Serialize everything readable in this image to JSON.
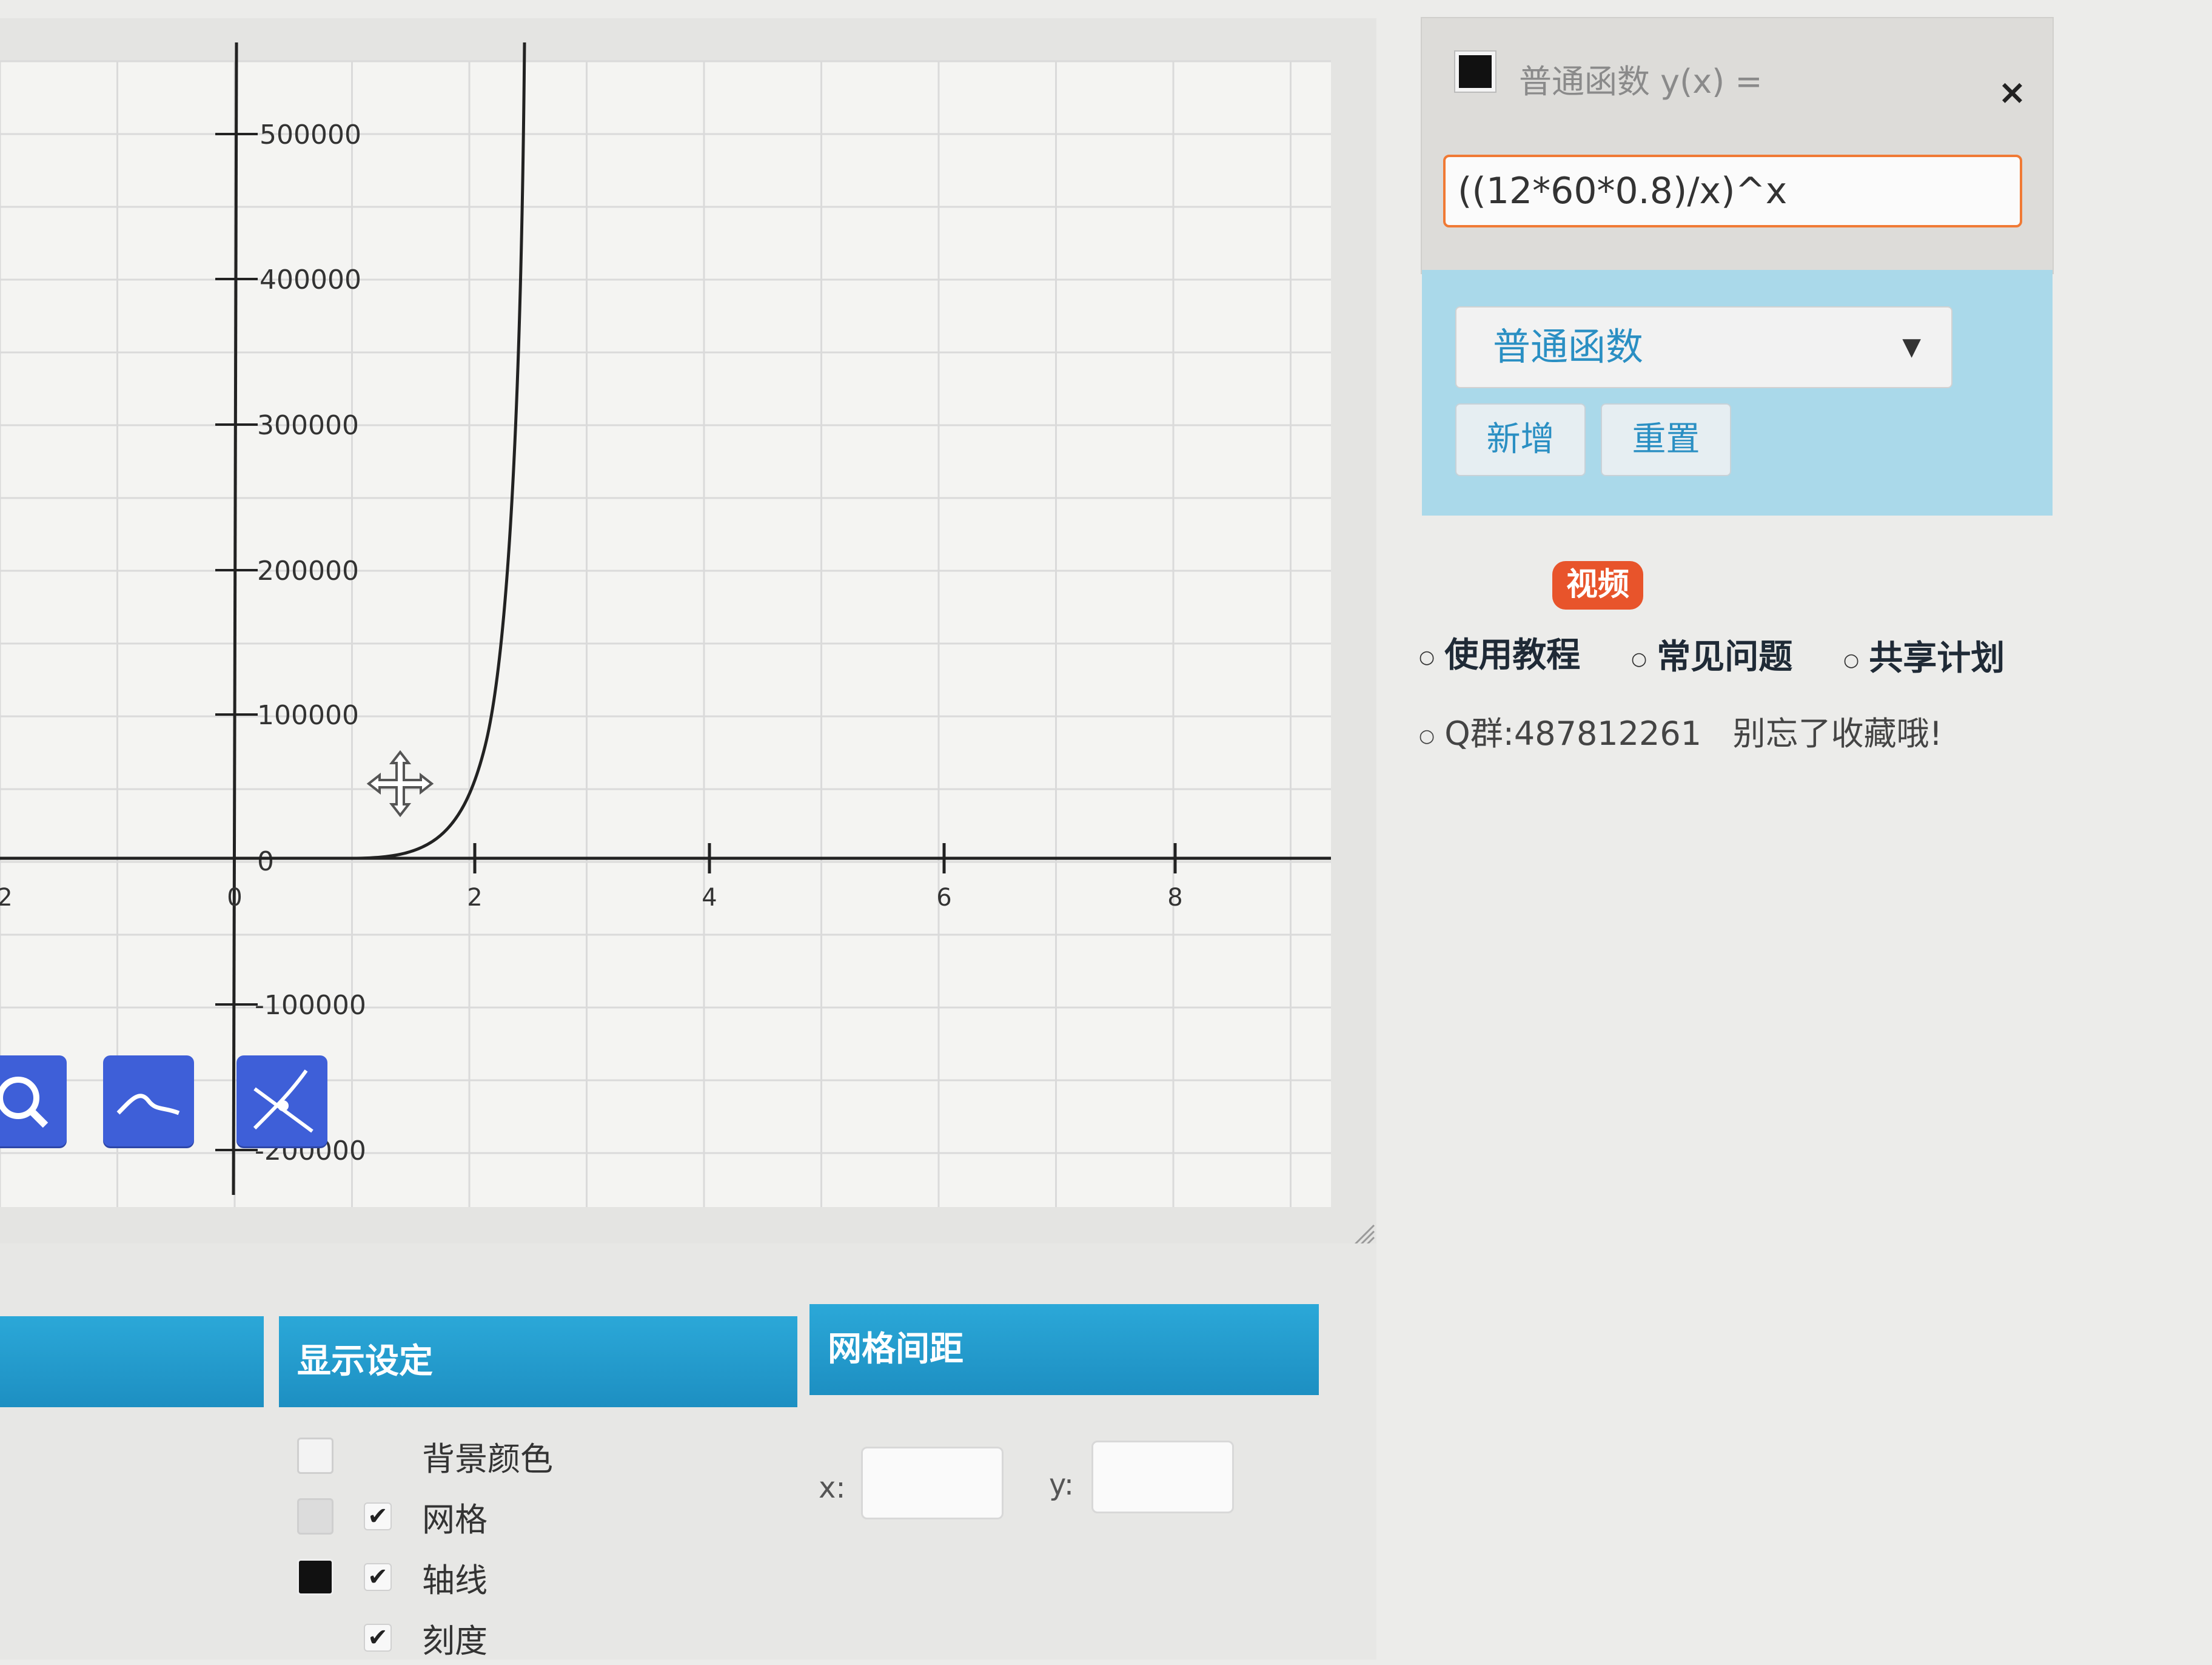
{
  "graph": {
    "x_ticks": [
      "2",
      "0",
      "2",
      "4",
      "6",
      "8"
    ],
    "y_ticks": [
      "500000",
      "400000",
      "300000",
      "200000",
      "100000",
      "0",
      "-100000",
      "-200000"
    ],
    "toolbar": {
      "zoom_icon": "zoom-icon",
      "curve_icon": "curve-icon",
      "tangent_icon": "tangent-icon"
    }
  },
  "function_card": {
    "title": "普通函数 y(x) =",
    "expression": "((12*60*0.8)/x)^x",
    "close": "×",
    "color": "#111111"
  },
  "function_type": {
    "selected": "普通函数",
    "add_label": "新增",
    "reset_label": "重置"
  },
  "help": {
    "video_badge": "视频",
    "links": [
      "使用教程",
      "常见问题",
      "共享计划"
    ],
    "qq_text": "Q群:487812261",
    "bookmark_text": "别忘了收藏哦!"
  },
  "settings": {
    "tabs": [
      "显示设定",
      "网格间距"
    ],
    "options": [
      {
        "label": "背景颜色",
        "checked": false
      },
      {
        "label": "网格",
        "checked": true
      },
      {
        "label": "轴线",
        "checked": true
      },
      {
        "label": "刻度",
        "checked": true
      }
    ],
    "grid_x_label": "x:",
    "grid_y_label": "y:"
  },
  "colors": {
    "accent": "#1d8fc2",
    "input_focus": "#f07a35",
    "toolbar": "#3e5fd8"
  }
}
